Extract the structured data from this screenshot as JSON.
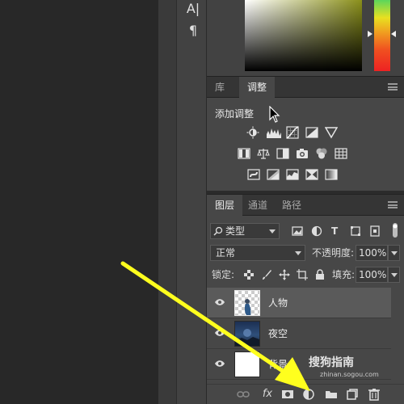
{
  "tools": {
    "type_tool_glyph": "A|",
    "paragraph_glyph": "¶"
  },
  "adjustments_panel": {
    "tabs": [
      {
        "label": "库",
        "active": false
      },
      {
        "label": "调整",
        "active": true
      }
    ],
    "title": "添加调整",
    "icons_row1": [
      "brightness-contrast-icon",
      "levels-icon",
      "curves-icon",
      "exposure-icon",
      "vibrance-icon"
    ],
    "icons_row2": [
      "hue-saturation-icon",
      "color-balance-icon",
      "black-white-icon",
      "photo-filter-icon",
      "channel-mixer-icon",
      "color-lookup-icon"
    ],
    "icons_row3": [
      "invert-icon",
      "posterize-icon",
      "threshold-icon",
      "selective-color-icon",
      "gradient-map-icon"
    ]
  },
  "layers_panel": {
    "tabs": [
      {
        "label": "图层",
        "active": true
      },
      {
        "label": "通道",
        "active": false
      },
      {
        "label": "路径",
        "active": false
      }
    ],
    "filter_kind": "类型",
    "blend_mode": "正常",
    "opacity_label": "不透明度:",
    "opacity_value": "100%",
    "lock_label": "锁定:",
    "fill_label": "填充:",
    "fill_value": "100%",
    "layers": [
      {
        "name": "人物",
        "visible": true,
        "selected": true
      },
      {
        "name": "夜空",
        "visible": true,
        "selected": false
      },
      {
        "name": "背景",
        "visible": true,
        "selected": false
      }
    ],
    "footer_fx": "fx"
  },
  "watermark": {
    "main": "搜狗指南",
    "sub": "zhinan.sogou.com"
  },
  "colors": {
    "arrow": "#ffff1e",
    "panel_bg": "#474747",
    "selected_row": "#5a5a5a"
  }
}
